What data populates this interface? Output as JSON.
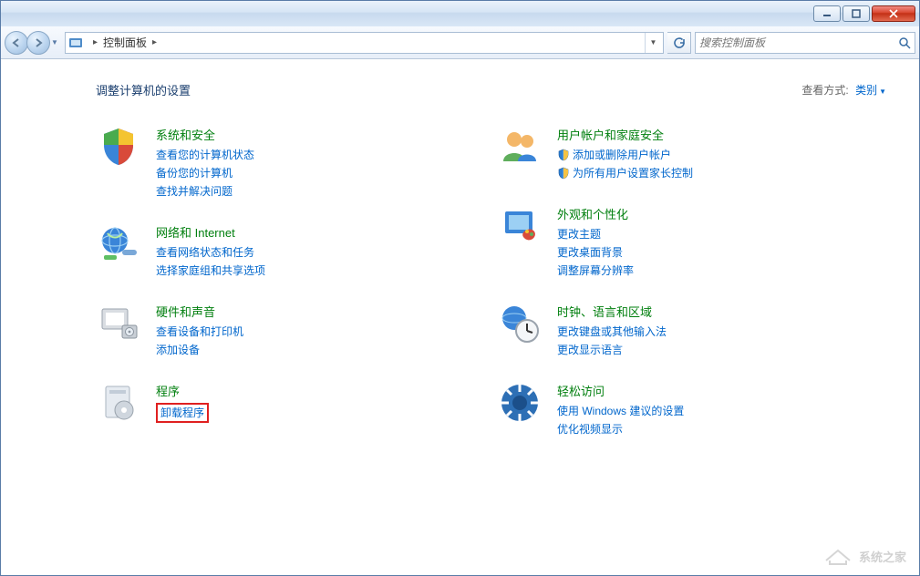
{
  "window": {
    "min_tip": "Minimize",
    "max_tip": "Maximize",
    "close_tip": "Close"
  },
  "nav": {
    "back_tip": "Back",
    "fwd_tip": "Forward",
    "recent_tip": "Recent locations"
  },
  "address": {
    "icon_name": "control-panel-icon",
    "segments": [
      "控制面板"
    ],
    "dropdown_tip": "Previous locations",
    "refresh_tip": "Refresh"
  },
  "search": {
    "placeholder": "搜索控制面板"
  },
  "page": {
    "title": "调整计算机的设置",
    "view_label": "查看方式:",
    "view_value": "类别"
  },
  "cols": [
    [
      {
        "icon": "system-security",
        "title": "系统和安全",
        "links": [
          {
            "text": "查看您的计算机状态",
            "shield": false
          },
          {
            "text": "备份您的计算机",
            "shield": false
          },
          {
            "text": "查找并解决问题",
            "shield": false
          }
        ]
      },
      {
        "icon": "network",
        "title": "网络和 Internet",
        "links": [
          {
            "text": "查看网络状态和任务",
            "shield": false
          },
          {
            "text": "选择家庭组和共享选项",
            "shield": false
          }
        ]
      },
      {
        "icon": "hardware",
        "title": "硬件和声音",
        "links": [
          {
            "text": "查看设备和打印机",
            "shield": false
          },
          {
            "text": "添加设备",
            "shield": false
          }
        ]
      },
      {
        "icon": "programs",
        "title": "程序",
        "links": [
          {
            "text": "卸载程序",
            "shield": false,
            "highlight": true
          }
        ]
      }
    ],
    [
      {
        "icon": "users",
        "title": "用户帐户和家庭安全",
        "links": [
          {
            "text": "添加或删除用户帐户",
            "shield": true
          },
          {
            "text": "为所有用户设置家长控制",
            "shield": true
          }
        ]
      },
      {
        "icon": "appearance",
        "title": "外观和个性化",
        "links": [
          {
            "text": "更改主题",
            "shield": false
          },
          {
            "text": "更改桌面背景",
            "shield": false
          },
          {
            "text": "调整屏幕分辨率",
            "shield": false
          }
        ]
      },
      {
        "icon": "clock",
        "title": "时钟、语言和区域",
        "links": [
          {
            "text": "更改键盘或其他输入法",
            "shield": false
          },
          {
            "text": "更改显示语言",
            "shield": false
          }
        ]
      },
      {
        "icon": "ease",
        "title": "轻松访问",
        "links": [
          {
            "text": "使用 Windows 建议的设置",
            "shield": false
          },
          {
            "text": "优化视频显示",
            "shield": false
          }
        ]
      }
    ]
  ],
  "watermark": "系统之家"
}
